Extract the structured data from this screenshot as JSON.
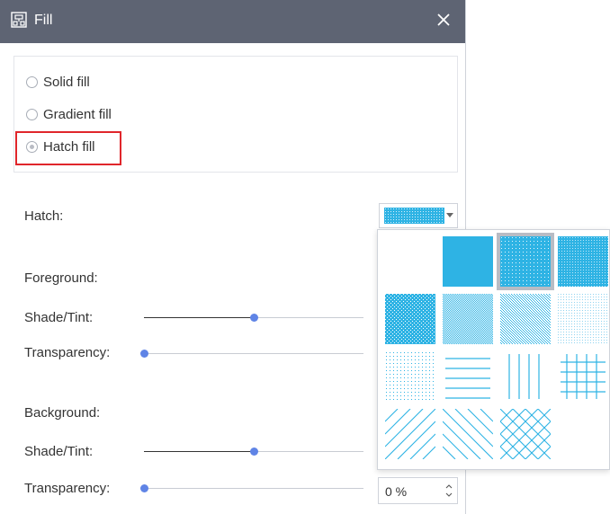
{
  "dialog": {
    "title": "Fill",
    "close_glyph": "✕"
  },
  "fill_types": [
    {
      "label": "Solid fill",
      "checked": false
    },
    {
      "label": "Gradient fill",
      "checked": false
    },
    {
      "label": "Hatch fill",
      "checked": true
    }
  ],
  "hatch": {
    "label": "Hatch:"
  },
  "foreground": {
    "heading": "Foreground:",
    "shade_label": "Shade/Tint:",
    "shade_value": 0.5,
    "transparency_label": "Transparency:",
    "transparency_value": 0
  },
  "background": {
    "heading": "Background:",
    "shade_label": "Shade/Tint:",
    "shade_value": 0.5,
    "transparency_label": "Transparency:",
    "transparency_value": 0,
    "transparency_field": "0 %"
  },
  "hatch_patterns": [
    "none",
    "solid",
    "sparse-dots",
    "dense-dots",
    "crosshatch-dense",
    "checker-fine",
    "checker-medium",
    "sparse-fine-dots",
    "dotted-grid",
    "horizontal-lines",
    "vertical-lines",
    "grid",
    "diagonal-up",
    "diagonal-down",
    "diagonal-cross"
  ],
  "selected_pattern": "sparse-dots",
  "colors": {
    "accent": "#2eb3e4",
    "knob": "#5f84e6",
    "titlebar": "#5e6473",
    "highlight": "#e0262b"
  }
}
